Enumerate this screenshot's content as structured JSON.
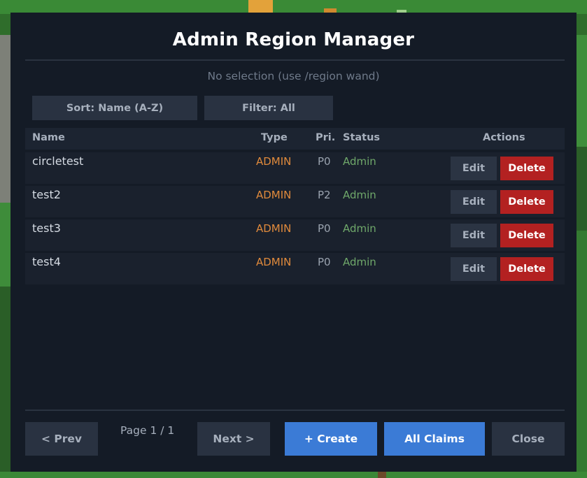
{
  "dialog": {
    "title": "Admin Region Manager",
    "selection_status": "No selection (use /region wand)"
  },
  "toolbar": {
    "sort_label": "Sort: Name (A-Z)",
    "filter_label": "Filter: All"
  },
  "table": {
    "columns": {
      "name": "Name",
      "type": "Type",
      "priority": "Pri.",
      "status": "Status",
      "actions": "Actions"
    },
    "rows": [
      {
        "name": "circletest",
        "type": "ADMIN",
        "priority": "P0",
        "status": "Admin",
        "edit": "Edit",
        "delete": "Delete"
      },
      {
        "name": "test2",
        "type": "ADMIN",
        "priority": "P2",
        "status": "Admin",
        "edit": "Edit",
        "delete": "Delete"
      },
      {
        "name": "test3",
        "type": "ADMIN",
        "priority": "P0",
        "status": "Admin",
        "edit": "Edit",
        "delete": "Delete"
      },
      {
        "name": "test4",
        "type": "ADMIN",
        "priority": "P0",
        "status": "Admin",
        "edit": "Edit",
        "delete": "Delete"
      }
    ]
  },
  "footer": {
    "prev_label": "< Prev",
    "page_indicator": "Page 1 / 1",
    "next_label": "Next >",
    "create_label": "+ Create",
    "all_claims_label": "All Claims",
    "close_label": "Close"
  },
  "colors": {
    "panel_bg": "#141b26",
    "type_admin": "#e08a3c",
    "status_admin": "#6fa86a",
    "delete_red": "#b32121",
    "primary_blue": "#3b7bd6"
  }
}
